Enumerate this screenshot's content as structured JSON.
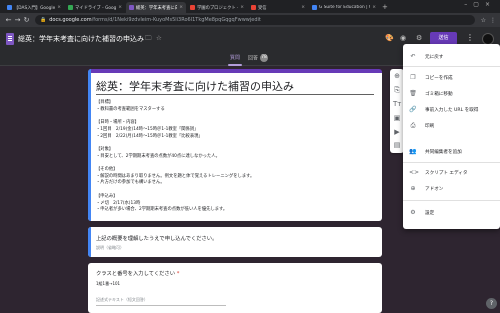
{
  "browser": {
    "tabs": [
      {
        "label": "【DAS入門】Google フォーム：",
        "color": "#4285f4",
        "active": false
      },
      {
        "label": "マイドライブ - Google ドライ",
        "color": "#34a853",
        "active": false
      },
      {
        "label": "総英：学年末考査に向けた補習",
        "color": "#7e57c2",
        "active": true
      },
      {
        "label": "学園のプロジェクト - プロジェ",
        "color": "#ea4335",
        "active": false
      },
      {
        "label": "受信",
        "color": "#ea4335",
        "active": false
      },
      {
        "label": "G Suite for Education | Goog",
        "color": "#4285f4",
        "active": false
      }
    ],
    "url_host": "docs.google.com",
    "url_path": "/forms/d/1Neki9zdvIeim-KuyoMs5li3Ro6l1TkgMe8pqGqgqFwwwjedit"
  },
  "form_header": {
    "title": "総英：学年末考査に向けた補習の申込み",
    "send_label": "送信"
  },
  "subtabs": {
    "questions": "質問",
    "responses": "回答",
    "response_count": "78"
  },
  "card": {
    "title": "総英：学年末考査に向けた補習の申込み",
    "description": "【目標】\n・教科書の考査範囲をマスターする\n\n【日時・場所・内容】\n・1回目　2/19(金)14時〜15時＠1-1教室「関係詞」\n・2回目　2/22(月)14時〜15時＠1-1教室「比較表現」\n\n【対象】\n・目安として、2学期期末考査の点数が40点に達しなかった人。\n\n【その他】\n・解説の時間はあまり取りません。例文を題と体で覚えるトレーニングをします。\n・片方だけの参加でも構いません。\n\n【申込み】\n・〆切　2/17(水)13時\n・申込者が多い場合、2学期期末考査の点数が低い人を優先します。"
  },
  "q1": {
    "text": "上記の概要を理解したうえで申し込んでください。",
    "sub": "説明（省略可）"
  },
  "q2": {
    "text": "クラスと番号を入力してください",
    "required": "*",
    "example": "1組1番→101",
    "placeholder": "記述式テキスト（短文回答）"
  },
  "menu": {
    "items": [
      {
        "icon": "↶",
        "label": "元に戻す"
      },
      {
        "icon": "❐",
        "label": "コピーを作成"
      },
      {
        "icon": "🗑",
        "label": "ゴミ箱に移動"
      },
      {
        "icon": "🔗",
        "label": "事前入力した URL を取得"
      },
      {
        "icon": "⎙",
        "label": "印刷"
      },
      {
        "icon": "👥",
        "label": "共同編集者を追加"
      },
      {
        "icon": "<>",
        "label": "スクリプト エディタ"
      },
      {
        "icon": "⊕",
        "label": "アドオン"
      },
      {
        "icon": "⚙",
        "label": "設定"
      }
    ]
  }
}
